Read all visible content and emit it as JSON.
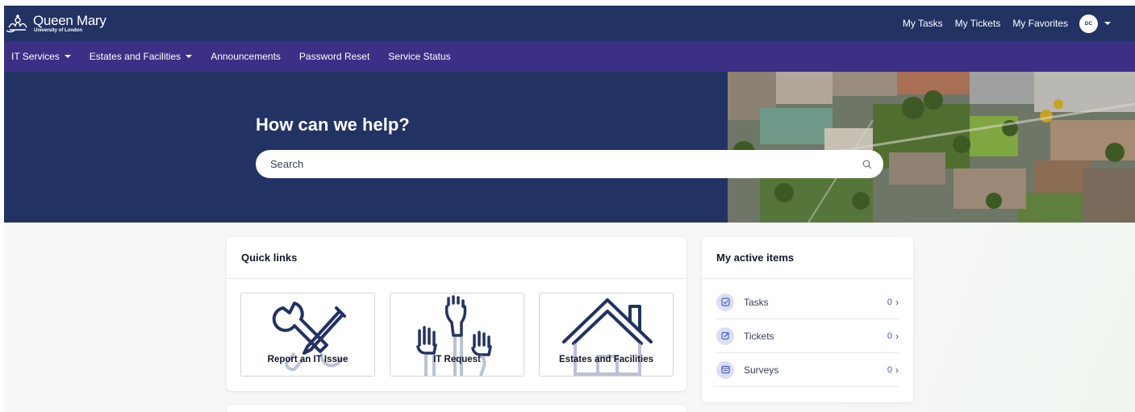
{
  "brand": {
    "name": "Queen Mary",
    "sub": "University of London"
  },
  "header": {
    "links": [
      "My Tasks",
      "My Tickets",
      "My Favorites"
    ],
    "avatar_initials": "DC"
  },
  "nav": {
    "items": [
      {
        "label": "IT Services",
        "has_dropdown": true
      },
      {
        "label": "Estates and Facilities",
        "has_dropdown": true
      },
      {
        "label": "Announcements",
        "has_dropdown": false
      },
      {
        "label": "Password Reset",
        "has_dropdown": false
      },
      {
        "label": "Service Status",
        "has_dropdown": false
      }
    ]
  },
  "hero": {
    "title": "How can we help?",
    "search_placeholder": "Search"
  },
  "quick_links": {
    "title": "Quick links",
    "tiles": [
      {
        "label": "Report an IT Issue",
        "icon": "tools-icon"
      },
      {
        "label": "IT Request",
        "icon": "raised-hands-icon"
      },
      {
        "label": "Estates and Facilities",
        "icon": "house-icon"
      }
    ]
  },
  "active_items": {
    "title": "My active items",
    "rows": [
      {
        "label": "Tasks",
        "count": "0",
        "icon": "task-check-icon"
      },
      {
        "label": "Tickets",
        "count": "0",
        "icon": "ticket-edit-icon"
      },
      {
        "label": "Surveys",
        "count": "0",
        "icon": "survey-icon"
      }
    ]
  },
  "colors": {
    "header_bg": "#223263",
    "nav_bg": "#3b2f86",
    "hero_bg": "#223263",
    "icon_navy": "#223263",
    "count_blue": "#3b5bdb"
  }
}
